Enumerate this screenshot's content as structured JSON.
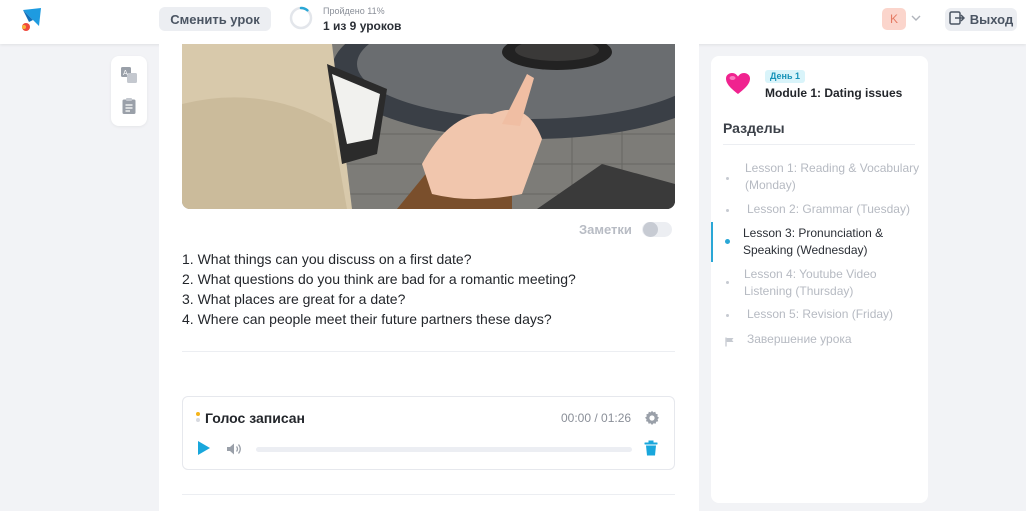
{
  "header": {
    "change_lesson": "Сменить урок",
    "progress_caption": "Пройдено 11%",
    "progress_main": "1 из 9 уроков",
    "progress_value": 0.11,
    "avatar_letter": "K",
    "logout": "Выход"
  },
  "main": {
    "notes_label": "Заметки",
    "notes_enabled": false,
    "questions": [
      "1. What things can you discuss on a first date?",
      "2. What questions do you think are bad for a romantic meeting?",
      "3. What places are great for a date?",
      "4. Where can people meet their future partners these days?"
    ],
    "audio": {
      "title": "Голос записан",
      "time": "00:00 / 01:26",
      "progress": 0
    }
  },
  "sidebar": {
    "day_badge": "День 1",
    "module_title": "Module 1: Dating issues",
    "sections_title": "Разделы",
    "lessons": [
      {
        "label": "Lesson 1: Reading & Vocabulary (Monday)",
        "active": false
      },
      {
        "label": "Lesson 2: Grammar (Tuesday)",
        "active": false
      },
      {
        "label": "Lesson 3: Pronunciation & Speaking (Wednesday)",
        "active": true
      },
      {
        "label": "Lesson 4: Youtube Video Listening (Thursday)",
        "active": false
      },
      {
        "label": "Lesson 5: Revision (Friday)",
        "active": false
      }
    ],
    "finish": "Завершение урока"
  },
  "colors": {
    "accent": "#2aa7d6",
    "day_badge_bg": "#d9f4fa",
    "avatar_bg": "#fbd5cc",
    "recording_dot": "#f5b41a"
  }
}
